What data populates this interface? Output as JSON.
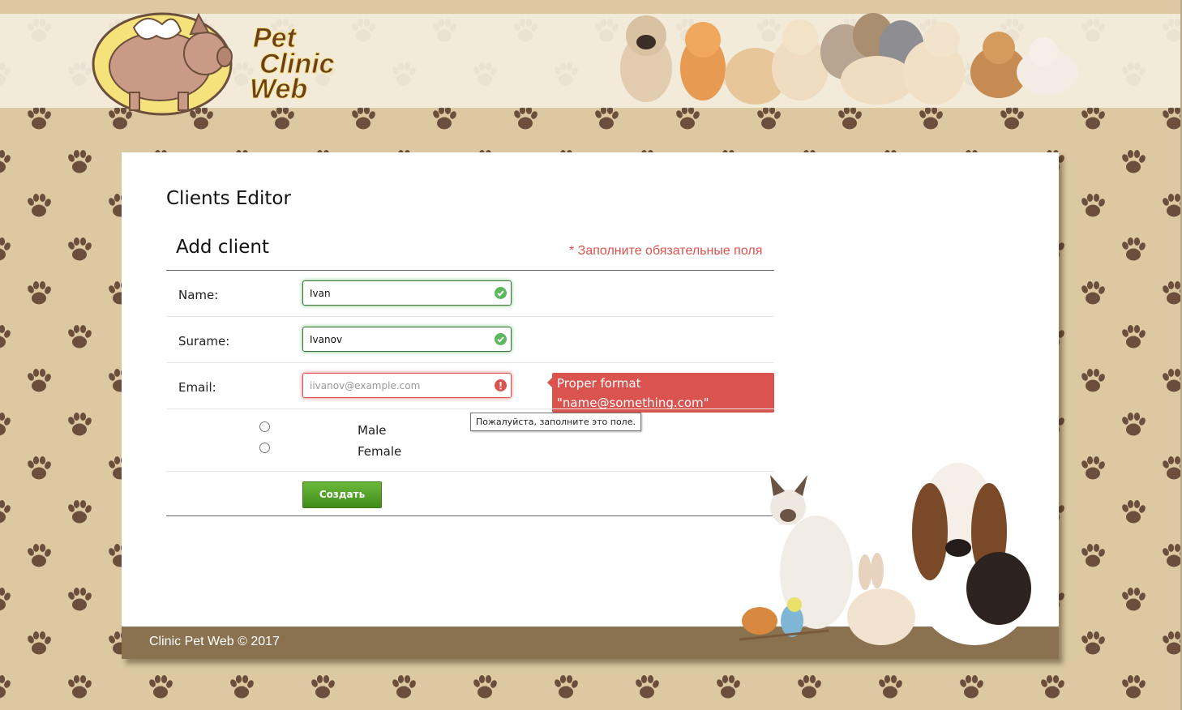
{
  "header": {
    "logo_word_1": "Pet",
    "logo_word_2": "Clinic",
    "logo_word_3": "Web"
  },
  "page": {
    "title": "Clients Editor"
  },
  "form": {
    "title": "Add client",
    "required_note": "* Заполните обязательные поля",
    "name": {
      "label": "Name:",
      "value": "Ivan",
      "status": "valid"
    },
    "surname": {
      "label": "Surame:",
      "value": "Ivanov",
      "status": "valid"
    },
    "email": {
      "label": "Email:",
      "value": "",
      "placeholder": "iivanov@example.com",
      "status": "invalid",
      "error_line_1": "Proper format",
      "error_line_2": "\"name@something.com\"",
      "tooltip": "Пожалуйста, заполните это поле."
    },
    "gender": [
      {
        "label": "Male",
        "checked": false
      },
      {
        "label": "Female",
        "checked": false
      }
    ],
    "submit_label": "Создать"
  },
  "footer": {
    "text": "Clinic Pet Web © 2017"
  },
  "colors": {
    "background": "#dcc9a1",
    "paw": "#6b4e3c",
    "footer": "#8a7150",
    "error": "#d9534f",
    "success": "#5cb85c",
    "button": "#4e9b23"
  }
}
